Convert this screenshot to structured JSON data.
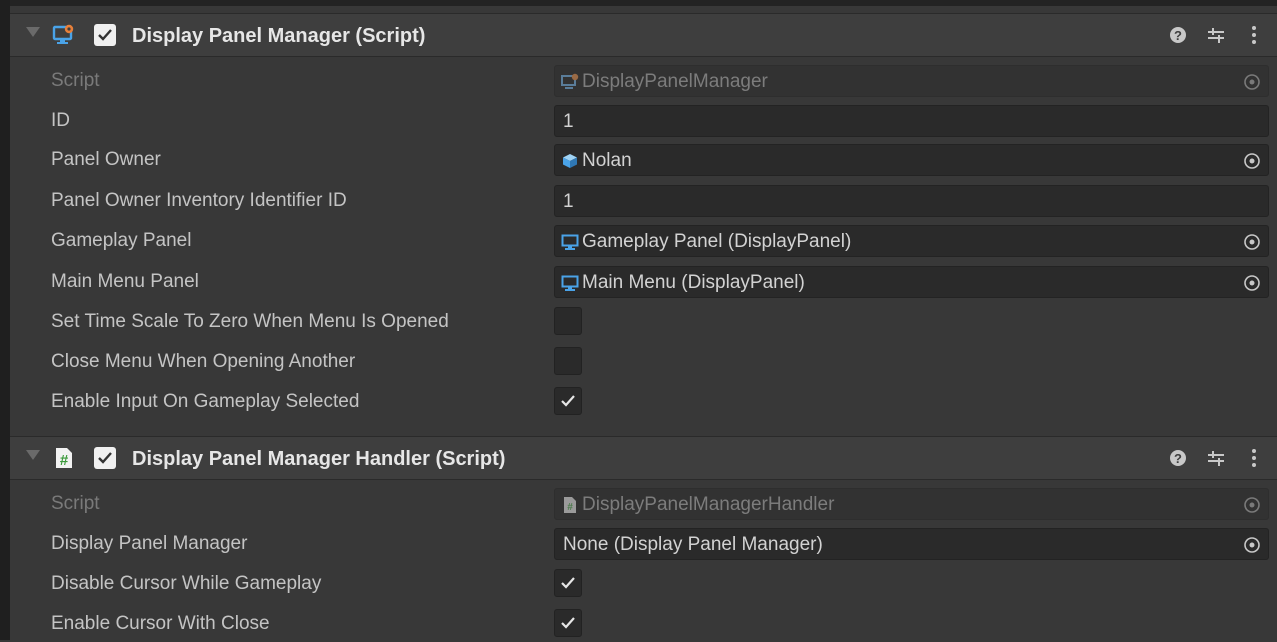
{
  "components": [
    {
      "title": "Display Panel Manager (Script)",
      "icon": "display-panel-manager-script-icon",
      "enabled": true,
      "fields": [
        {
          "label": "Script",
          "type": "object",
          "value": "DisplayPanelManager",
          "icon": "script-monitor-icon",
          "disabled": true
        },
        {
          "label": "ID",
          "type": "text",
          "value": "1"
        },
        {
          "label": "Panel Owner",
          "type": "object",
          "value": "Nolan",
          "icon": "prefab-cube-icon"
        },
        {
          "label": "Panel Owner Inventory Identifier ID",
          "type": "text",
          "value": "1"
        },
        {
          "label": "Gameplay Panel",
          "type": "object",
          "value": "Gameplay Panel (DisplayPanel)",
          "icon": "display-panel-icon"
        },
        {
          "label": "Main Menu Panel",
          "type": "object",
          "value": "Main Menu (DisplayPanel)",
          "icon": "display-panel-icon"
        },
        {
          "label": "Set Time Scale To Zero When Menu Is Opened",
          "type": "bool",
          "value": false
        },
        {
          "label": "Close Menu When Opening Another",
          "type": "bool",
          "value": false
        },
        {
          "label": "Enable Input On Gameplay Selected",
          "type": "bool",
          "value": true
        }
      ]
    },
    {
      "title": "Display Panel Manager Handler (Script)",
      "icon": "csharp-script-icon",
      "enabled": true,
      "fields": [
        {
          "label": "Script",
          "type": "object",
          "value": "DisplayPanelManagerHandler",
          "icon": "script-file-icon",
          "disabled": true
        },
        {
          "label": "Display Panel Manager",
          "type": "object",
          "value": "None (Display Panel Manager)",
          "icon": ""
        },
        {
          "label": "Disable Cursor While Gameplay",
          "type": "bool",
          "value": true
        },
        {
          "label": "Enable Cursor With Close",
          "type": "bool",
          "value": true
        }
      ]
    }
  ],
  "colors": {
    "background": "#383838",
    "header": "#3e3e3e",
    "field": "#2a2a2a",
    "accent_blue": "#4aa3e8",
    "accent_orange": "#e8803a"
  }
}
